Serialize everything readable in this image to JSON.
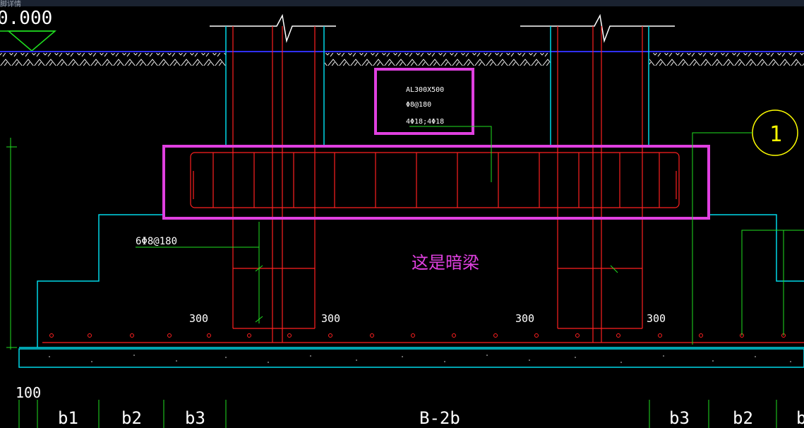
{
  "window": {
    "title_fragment": "脚详情"
  },
  "drawing": {
    "elevation_label": "0.000",
    "beam_callout": {
      "name": "AL300X500",
      "stirrup": "Φ8@180",
      "main_bars": "4Φ18;4Φ18"
    },
    "tie_label": "6Φ8@180",
    "annotation": "这是暗梁",
    "grid_bubble": "1",
    "dimensions": {
      "bottom_left": "100",
      "offsets": [
        "300",
        "300",
        "300",
        "300"
      ]
    },
    "strip_labels": [
      "b1",
      "b2",
      "b3",
      "B-2b",
      "b3",
      "b2",
      "b"
    ],
    "colors": {
      "rebar": "#ff2020",
      "outline": "#00d8e8",
      "leader": "#20e020",
      "highlight": "#e040e0",
      "grade_line": "#3030ff",
      "text": "#ffffff",
      "bubble": "#ffff00"
    }
  }
}
